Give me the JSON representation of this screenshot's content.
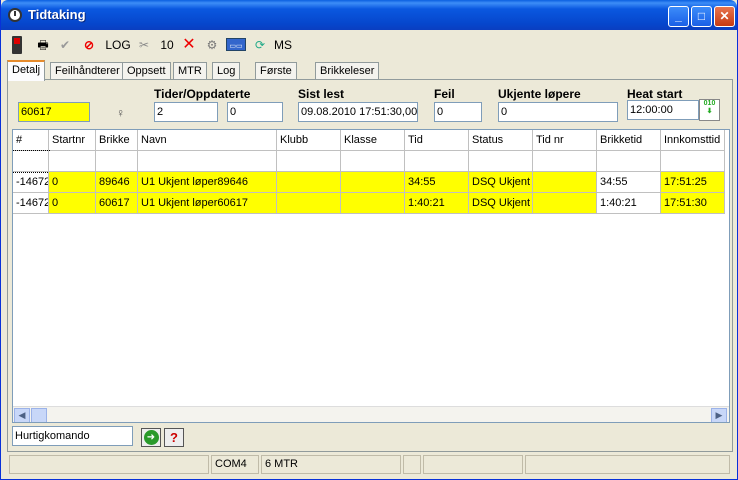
{
  "window": {
    "title": "Tidtaking"
  },
  "toolbar": {
    "log_label": "LOG",
    "count_label": "10",
    "ms_label": "MS"
  },
  "tabs": [
    {
      "label": "Detalj"
    },
    {
      "label": "Feilhåndterer"
    },
    {
      "label": "Oppsett"
    },
    {
      "label": "MTR"
    },
    {
      "label": "Log"
    },
    {
      "label": "Første side"
    },
    {
      "label": "Brikkeleser klokke"
    }
  ],
  "detail": {
    "brikke_value": "60617",
    "tider_label": "Tider/Oppdaterte",
    "tider_value": "2",
    "oppdaterte_value": "0",
    "sist_lest_label": "Sist lest",
    "sist_lest_value": "09.08.2010 17:51:30,00",
    "feil_label": "Feil",
    "feil_value": "0",
    "ukjente_label": "Ukjente løpere",
    "ukjente_value": "0",
    "heat_label": "Heat start",
    "heat_value": "12:00:00"
  },
  "grid": {
    "columns": [
      "#",
      "Startnr",
      "Brikke",
      "Navn",
      "Klubb",
      "Klasse",
      "Tid",
      "Status",
      "Tid nr",
      "Brikketid",
      "Innkomsttid"
    ],
    "rows": [
      [
        "-14672",
        "0",
        "89646",
        "U1 Ukjent løper89646",
        "",
        "",
        "34:55",
        "DSQ Ukjent l",
        "",
        "34:55",
        "17:51:25"
      ],
      [
        "-14672",
        "0",
        "60617",
        "U1 Ukjent løper60617",
        "",
        "",
        "1:40:21",
        "DSQ Ukjent l",
        "",
        "1:40:21",
        "17:51:30"
      ]
    ]
  },
  "quick": {
    "value": "Hurtigkomando"
  },
  "status": {
    "port": "COM4",
    "mtr": "6  MTR"
  },
  "colors": {
    "highlight": "#ffff00",
    "titlebar": "#0a58e0"
  }
}
